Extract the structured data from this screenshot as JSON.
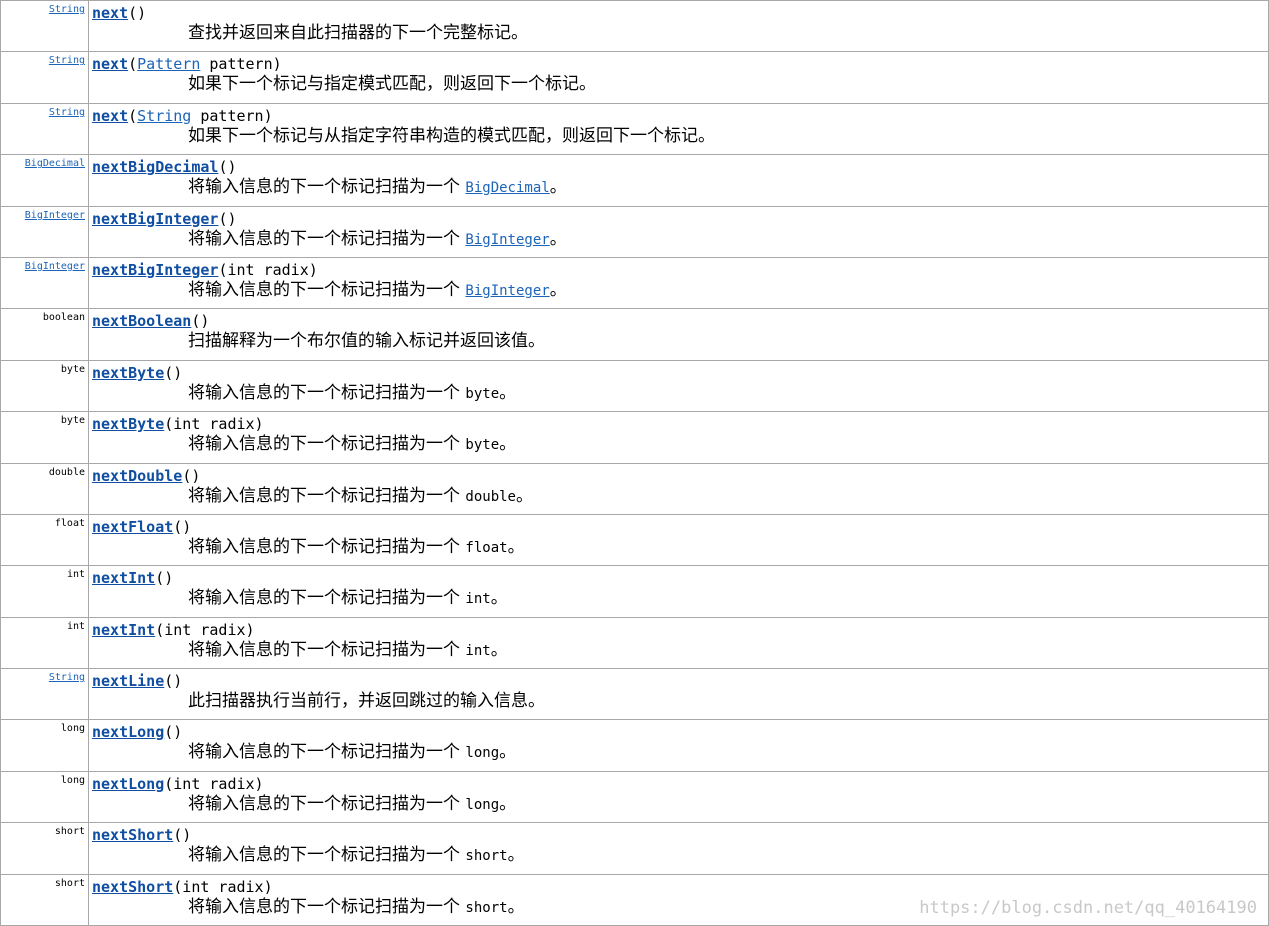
{
  "rows": [
    {
      "type": "String",
      "type_link": true,
      "name": "next",
      "params": "()",
      "param_link": "",
      "param_rest": "",
      "desc": "查找并返回来自此扫描器的下一个完整标记。",
      "code": "",
      "code_link": false
    },
    {
      "type": "String",
      "type_link": true,
      "name": "next",
      "params": "",
      "param_link": "Pattern",
      "param_rest": " pattern)",
      "desc": "如果下一个标记与指定模式匹配，则返回下一个标记。",
      "code": "",
      "code_link": false
    },
    {
      "type": "String",
      "type_link": true,
      "name": "next",
      "params": "",
      "param_link": "String",
      "param_rest": " pattern)",
      "desc": "如果下一个标记与从指定字符串构造的模式匹配，则返回下一个标记。",
      "code": "",
      "code_link": false
    },
    {
      "type": "BigDecimal",
      "type_link": true,
      "name": "nextBigDecimal",
      "params": "()",
      "param_link": "",
      "param_rest": "",
      "desc": "将输入信息的下一个标记扫描为一个 ",
      "code": "BigDecimal",
      "code_link": true
    },
    {
      "type": "BigInteger",
      "type_link": true,
      "name": "nextBigInteger",
      "params": "()",
      "param_link": "",
      "param_rest": "",
      "desc": "将输入信息的下一个标记扫描为一个 ",
      "code": "BigInteger",
      "code_link": true
    },
    {
      "type": "BigInteger",
      "type_link": true,
      "name": "nextBigInteger",
      "params": "(int radix)",
      "param_link": "",
      "param_rest": "",
      "desc": "将输入信息的下一个标记扫描为一个 ",
      "code": "BigInteger",
      "code_link": true
    },
    {
      "type": "boolean",
      "type_link": false,
      "name": "nextBoolean",
      "params": "()",
      "param_link": "",
      "param_rest": "",
      "desc": "扫描解释为一个布尔值的输入标记并返回该值。",
      "code": "",
      "code_link": false
    },
    {
      "type": "byte",
      "type_link": false,
      "name": "nextByte",
      "params": "()",
      "param_link": "",
      "param_rest": "",
      "desc": "将输入信息的下一个标记扫描为一个 ",
      "code": "byte",
      "code_link": false
    },
    {
      "type": "byte",
      "type_link": false,
      "name": "nextByte",
      "params": "(int radix)",
      "param_link": "",
      "param_rest": "",
      "desc": "将输入信息的下一个标记扫描为一个 ",
      "code": "byte",
      "code_link": false
    },
    {
      "type": "double",
      "type_link": false,
      "name": "nextDouble",
      "params": "()",
      "param_link": "",
      "param_rest": "",
      "desc": "将输入信息的下一个标记扫描为一个 ",
      "code": "double",
      "code_link": false
    },
    {
      "type": "float",
      "type_link": false,
      "name": "nextFloat",
      "params": "()",
      "param_link": "",
      "param_rest": "",
      "desc": "将输入信息的下一个标记扫描为一个 ",
      "code": "float",
      "code_link": false
    },
    {
      "type": "int",
      "type_link": false,
      "name": "nextInt",
      "params": "()",
      "param_link": "",
      "param_rest": "",
      "desc": "将输入信息的下一个标记扫描为一个 ",
      "code": "int",
      "code_link": false
    },
    {
      "type": "int",
      "type_link": false,
      "name": "nextInt",
      "params": "(int radix)",
      "param_link": "",
      "param_rest": "",
      "desc": "将输入信息的下一个标记扫描为一个 ",
      "code": "int",
      "code_link": false
    },
    {
      "type": "String",
      "type_link": true,
      "name": "nextLine",
      "params": "()",
      "param_link": "",
      "param_rest": "",
      "desc": "此扫描器执行当前行，并返回跳过的输入信息。",
      "code": "",
      "code_link": false
    },
    {
      "type": "long",
      "type_link": false,
      "name": "nextLong",
      "params": "()",
      "param_link": "",
      "param_rest": "",
      "desc": "将输入信息的下一个标记扫描为一个 ",
      "code": "long",
      "code_link": false
    },
    {
      "type": "long",
      "type_link": false,
      "name": "nextLong",
      "params": "(int radix)",
      "param_link": "",
      "param_rest": "",
      "desc": "将输入信息的下一个标记扫描为一个 ",
      "code": "long",
      "code_link": false
    },
    {
      "type": "short",
      "type_link": false,
      "name": "nextShort",
      "params": "()",
      "param_link": "",
      "param_rest": "",
      "desc": "将输入信息的下一个标记扫描为一个 ",
      "code": "short",
      "code_link": false
    },
    {
      "type": "short",
      "type_link": false,
      "name": "nextShort",
      "params": "(int radix)",
      "param_link": "",
      "param_rest": "",
      "desc": "将输入信息的下一个标记扫描为一个 ",
      "code": "short",
      "code_link": false
    }
  ],
  "watermark": "https://blog.csdn.net/qq_40164190",
  "colors": {
    "link": "#1c64b8",
    "method_link": "#0f4ea1",
    "border": "#a8a8a8",
    "watermark": "#c8c8c8"
  }
}
